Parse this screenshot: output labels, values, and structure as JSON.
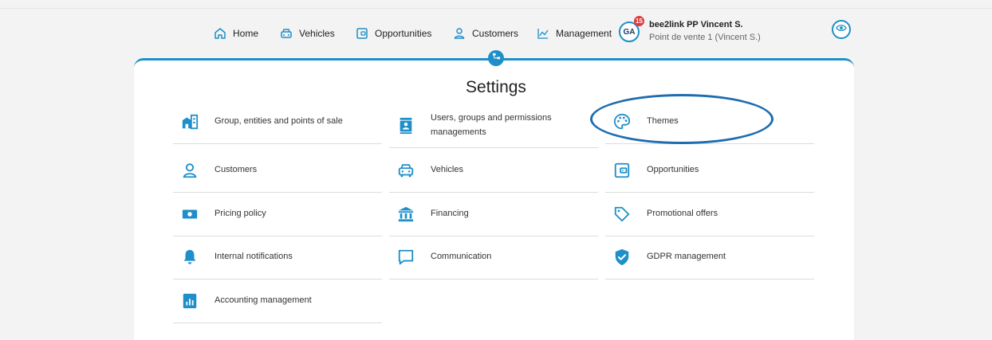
{
  "nav": {
    "home": "Home",
    "vehicles": "Vehicles",
    "opportunities": "Opportunities",
    "customers": "Customers",
    "management": "Management"
  },
  "user": {
    "initials": "GA",
    "notifications": "15",
    "name": "bee2link PP Vincent S.",
    "point_of_sale": "Point de vente 1 (Vincent S.)"
  },
  "page": {
    "title": "Settings"
  },
  "settings": {
    "group_entities": "Group, entities and points of sale",
    "users_groups": "Users, groups and permissions managements",
    "themes": "Themes",
    "customers": "Customers",
    "vehicles": "Vehicles",
    "opportunities": "Opportunities",
    "pricing_policy": "Pricing policy",
    "financing": "Financing",
    "promotional_offers": "Promotional offers",
    "internal_notifications": "Internal notifications",
    "communication": "Communication",
    "gdpr": "GDPR management",
    "accounting": "Accounting management"
  },
  "colors": {
    "accent": "#1e8fc8",
    "highlight_ellipse": "#1d6db0",
    "badge": "#e03b3b"
  },
  "icons": {
    "nav_home": "home-icon",
    "nav_vehicles": "car-icon",
    "nav_opportunities": "wallet-icon",
    "nav_customers": "user-icon",
    "nav_management": "line-chart-icon",
    "eye": "eye-icon",
    "handle": "org-chart-icon"
  }
}
